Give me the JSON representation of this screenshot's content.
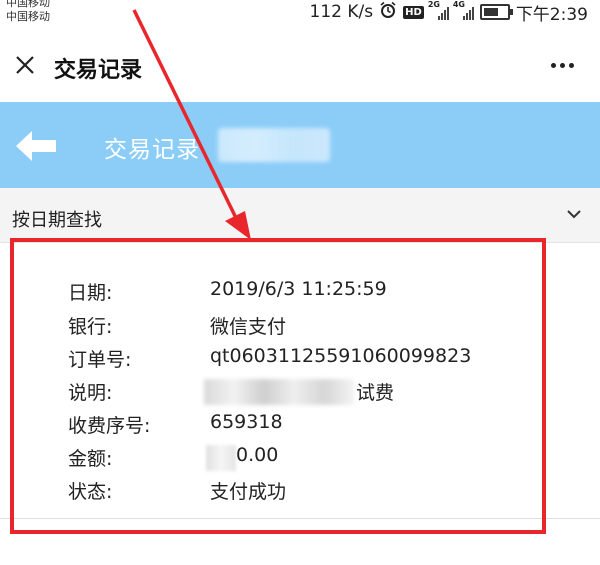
{
  "status_bar": {
    "carrier_1": "中国移动",
    "carrier_2": "中国移动",
    "net_speed": "112 K/s",
    "alarm_icon": "alarm-clock-icon",
    "hd_label": "HD",
    "net_2g": "2G",
    "net_4g": "4G",
    "time": "下午2:39"
  },
  "titlebar": {
    "title": "交易记录",
    "close_icon": "close-icon",
    "more_icon": "more-horizontal-icon"
  },
  "header": {
    "back_icon": "back-arrow-icon",
    "title": "交易记录",
    "bg_color": "#8ccdf8"
  },
  "filter": {
    "label": "按日期查找",
    "icon": "chevron-down-icon"
  },
  "detail": {
    "rows": [
      {
        "label": "日期:",
        "value": "2019/6/3 11:25:59"
      },
      {
        "label": "银行:",
        "value": "微信支付"
      },
      {
        "label": "订单号:",
        "value": "qt060311255910600998​23"
      },
      {
        "label": "说明:",
        "value": "试费"
      },
      {
        "label": "收费序号:",
        "value": "659318"
      },
      {
        "label": "金额:",
        "value": "0.00"
      },
      {
        "label": "状态:",
        "value": "支付成功"
      }
    ]
  },
  "annotation": {
    "color": "#e8262c"
  }
}
